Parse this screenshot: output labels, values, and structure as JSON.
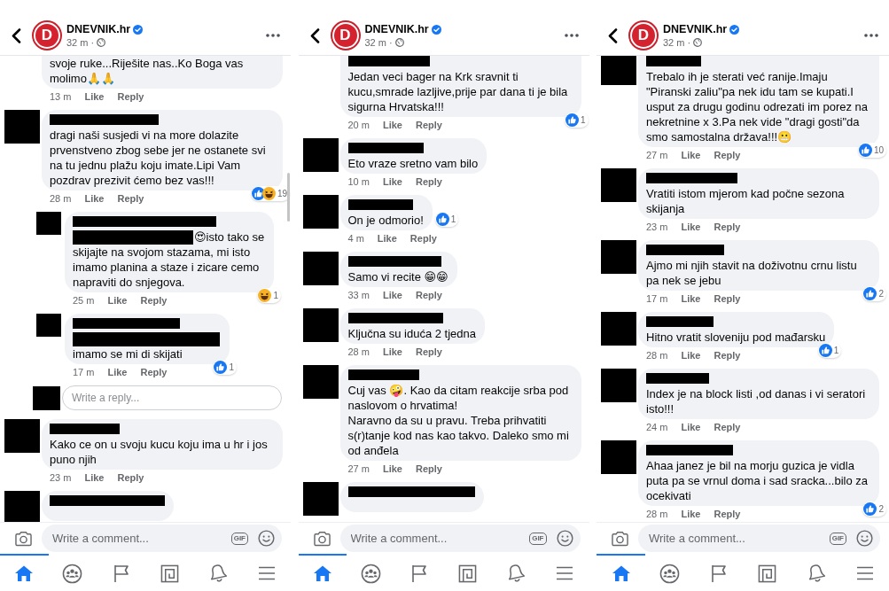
{
  "panels": [
    {
      "header": {
        "logo_text": "D",
        "page_name": "DNEVNIK.hr",
        "verified": true,
        "time": "32 m ·"
      },
      "scroll_indicator": true,
      "comments": [
        {
          "redacted_avatar": false,
          "redacted_name": false,
          "text": "svoje ruke...Riješite nas..Ko Boga vas molimo🙏🙏",
          "time": "13 m",
          "actions": [
            "Like",
            "Reply"
          ]
        },
        {
          "redacted_avatar": true,
          "redacted_name": true,
          "text": "dragi naši susjedi vi na more dolazite prvenstveno zbog sebe jer ne ostanete svi na tu jednu plažu koju imate.Lipi Vam pozdrav prezivit ćemo bez vas!!!",
          "time": "28 m",
          "actions": [
            "Like",
            "Reply"
          ],
          "reactions": {
            "beside_bubble": false,
            "icons": [
              {
                "kind": "like"
              },
              {
                "kind": "haha"
              }
            ],
            "count": "19"
          },
          "children": [
            {
              "redacted_avatar": true,
              "redacted_name": true,
              "redacted_lead": true,
              "text": "😍isto tako se skijajte na svojom stazama, mi isto imamo planina a staze i zicare cemo napraviti do snjegova.",
              "time": "25 m",
              "actions": [
                "Like",
                "Reply"
              ],
              "reactions": {
                "beside_bubble": false,
                "icons": [
                  {
                    "kind": "haha"
                  }
                ],
                "count": "1"
              }
            },
            {
              "redacted_avatar": true,
              "redacted_name": true,
              "redacted_lead": true,
              "text": "imamo se mi di skijati",
              "time": "17 m",
              "actions": [
                "Like",
                "Reply"
              ],
              "reactions": {
                "beside_bubble": false,
                "icons": [
                  {
                    "kind": "like"
                  }
                ],
                "count": "1"
              }
            }
          ],
          "reply_field": {
            "placeholder": "Write a reply..."
          }
        },
        {
          "redacted_avatar": true,
          "redacted_name": true,
          "text": "Kako ce on u svoju kucu koju ima u hr i jos puno njih",
          "time": "23 m",
          "actions": [
            "Like",
            "Reply"
          ]
        },
        {
          "redacted_avatar": true,
          "redacted_name": true
        }
      ],
      "composer": {
        "placeholder": "Write a comment...",
        "gif_label": "GIF"
      },
      "nav_tabs": [
        {
          "kind": "home",
          "selected": true
        },
        {
          "kind": "groups",
          "selected": false
        },
        {
          "kind": "pages",
          "selected": false
        },
        {
          "kind": "gaming",
          "selected": false
        },
        {
          "kind": "notifications",
          "selected": false
        },
        {
          "kind": "menu",
          "selected": false
        }
      ]
    },
    {
      "header": {
        "logo_text": "D",
        "page_name": "DNEVNIK.hr",
        "verified": true,
        "time": "32 m ·"
      },
      "comments": [
        {
          "redacted_avatar": false,
          "redacted_name": true,
          "text": "Jedan veci bager na Krk sravnit ti kucu,smrade lazljive,prije par dana ti je bila sigurna Hrvatska!!!",
          "time": "20 m",
          "actions": [
            "Like",
            "Reply"
          ],
          "reactions": {
            "beside_bubble": false,
            "icons": [
              {
                "kind": "like"
              }
            ],
            "count": "1"
          }
        },
        {
          "redacted_avatar": true,
          "redacted_name": true,
          "text": "Eto vraze sretno vam bilo",
          "time": "10 m",
          "actions": [
            "Like",
            "Reply"
          ]
        },
        {
          "redacted_avatar": true,
          "redacted_name": true,
          "text": "On je odmorio!",
          "time": "4 m",
          "actions": [
            "Like",
            "Reply"
          ],
          "reactions": {
            "beside_bubble": true,
            "icons": [
              {
                "kind": "like"
              }
            ],
            "count": "1"
          }
        },
        {
          "redacted_avatar": true,
          "redacted_name": true,
          "text": "Samo vi recite 😁😁",
          "time": "33 m",
          "actions": [
            "Like",
            "Reply"
          ]
        },
        {
          "redacted_avatar": true,
          "redacted_name": true,
          "text": "Ključna su iduća 2 tjedna",
          "time": "28 m",
          "actions": [
            "Like",
            "Reply"
          ]
        },
        {
          "redacted_avatar": true,
          "redacted_name": true,
          "text": "Cuj vas 🤪. Kao da citam reakcije srba pod naslovom o hrvatima!\nNaravno da su u pravu. Treba prihvatiti s(r)tanje kod nas kao takvo. Daleko smo mi od anđela",
          "time": "27 m",
          "actions": [
            "Like",
            "Reply"
          ]
        },
        {
          "redacted_avatar": true,
          "redacted_name": true
        }
      ],
      "composer": {
        "placeholder": "Write a comment...",
        "gif_label": "GIF"
      },
      "nav_tabs": [
        {
          "kind": "home",
          "selected": true
        },
        {
          "kind": "groups",
          "selected": false
        },
        {
          "kind": "pages",
          "selected": false
        },
        {
          "kind": "gaming",
          "selected": false
        },
        {
          "kind": "notifications",
          "selected": false
        },
        {
          "kind": "menu",
          "selected": false
        }
      ]
    },
    {
      "header": {
        "logo_text": "D",
        "page_name": "DNEVNIK.hr",
        "verified": true,
        "time": "32 m ·"
      },
      "comments": [
        {
          "redacted_avatar": true,
          "redacted_name": true,
          "text": "Trebalo ih je sterati već ranije.Imaju \"Piranski zaliu\"pa nek idu tam se kupati.I usput za drugu godinu odrezati im porez na nekretnine x 3.Pa nek vide \"dragi gosti\"da smo samostalna država!!!😬",
          "time": "27 m",
          "actions": [
            "Like",
            "Reply"
          ],
          "reactions": {
            "beside_bubble": false,
            "icons": [
              {
                "kind": "like"
              }
            ],
            "count": "10"
          }
        },
        {
          "redacted_avatar": true,
          "redacted_name": true,
          "text": "Vratiti istom mjerom kad počne sezona skijanja",
          "time": "23 m",
          "actions": [
            "Like",
            "Reply"
          ]
        },
        {
          "redacted_avatar": true,
          "redacted_name": true,
          "text": "Ajmo mi njih stavit na doživotnu crnu listu pa nek se jebu",
          "time": "17 m",
          "actions": [
            "Like",
            "Reply"
          ],
          "reactions": {
            "beside_bubble": false,
            "icons": [
              {
                "kind": "like"
              }
            ],
            "count": "2"
          }
        },
        {
          "redacted_avatar": true,
          "redacted_name": true,
          "text": "Hitno vratit sloveniju pod mađarsku",
          "time": "28 m",
          "actions": [
            "Like",
            "Reply"
          ],
          "reactions": {
            "beside_bubble": false,
            "icons": [
              {
                "kind": "like"
              }
            ],
            "count": "1"
          }
        },
        {
          "redacted_avatar": true,
          "redacted_name": true,
          "text": "Index je na block listi ,od danas i vi seratori isto!!!",
          "time": "24 m",
          "actions": [
            "Like",
            "Reply"
          ]
        },
        {
          "redacted_avatar": true,
          "redacted_name": true,
          "text": "Ahaa janez je bil na morju guzica je vidla puta pa se vrnul doma i sad sracka...bilo za ocekivati",
          "time": "28 m",
          "actions": [
            "Like",
            "Reply"
          ],
          "reactions": {
            "beside_bubble": false,
            "icons": [
              {
                "kind": "like"
              }
            ],
            "count": "2"
          }
        }
      ],
      "composer": {
        "placeholder": "Write a comment...",
        "gif_label": "GIF"
      },
      "nav_tabs": [
        {
          "kind": "home",
          "selected": true
        },
        {
          "kind": "groups",
          "selected": false
        },
        {
          "kind": "pages",
          "selected": false
        },
        {
          "kind": "gaming",
          "selected": false
        },
        {
          "kind": "notifications",
          "selected": false
        },
        {
          "kind": "menu",
          "selected": false
        }
      ]
    }
  ]
}
